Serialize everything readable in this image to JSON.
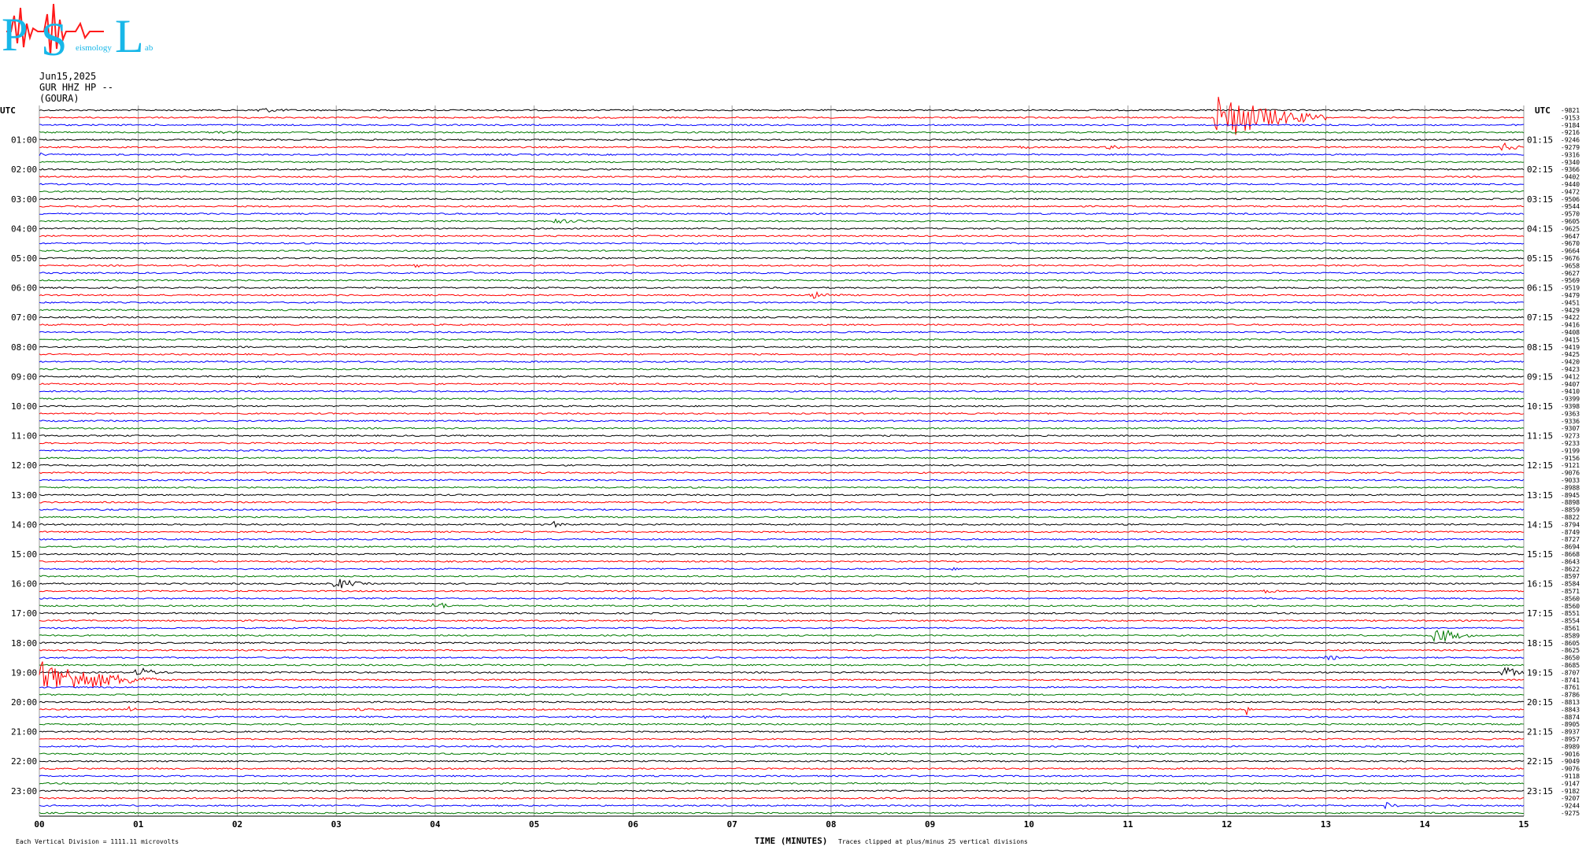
{
  "logo": {
    "letters": [
      "P",
      "S",
      "L"
    ],
    "words": [
      "eismology",
      "ab"
    ]
  },
  "header": {
    "date": "Jun15,2025",
    "channel": "GUR HHZ HP --",
    "station": "(GOURA)"
  },
  "chart_data": {
    "type": "line",
    "chart_kind": "helicorder",
    "title": "",
    "xlabel": "TIME (MINUTES)",
    "x_ticks": [
      "00",
      "01",
      "02",
      "03",
      "04",
      "05",
      "06",
      "07",
      "08",
      "09",
      "10",
      "11",
      "12",
      "13",
      "14",
      "15"
    ],
    "xlim": [
      0,
      15
    ],
    "utc_label_left": "UTC",
    "utc_label_right": "UTC",
    "left_hour_labels": [
      "01:00",
      "02:00",
      "03:00",
      "04:00",
      "05:00",
      "06:00",
      "07:00",
      "08:00",
      "09:00",
      "10:00",
      "11:00",
      "12:00",
      "13:00",
      "14:00",
      "15:00",
      "16:00",
      "17:00",
      "18:00",
      "19:00",
      "20:00",
      "21:00",
      "22:00",
      "23:00"
    ],
    "right_hour_labels": [
      "01:15",
      "02:15",
      "03:15",
      "04:15",
      "05:15",
      "06:15",
      "07:15",
      "08:15",
      "09:15",
      "10:15",
      "11:15",
      "12:15",
      "13:15",
      "14:15",
      "15:15",
      "16:15",
      "17:15",
      "18:15",
      "19:15",
      "20:15",
      "21:15",
      "22:15",
      "23:15"
    ],
    "trace_colors": [
      "#000000",
      "#ff0000",
      "#0000ff",
      "#007a00"
    ],
    "trace_count": 96,
    "right_offsets": [
      "-9821",
      "-9153",
      "-9184",
      "-9216",
      "-9246",
      "-9279",
      "-9316",
      "-9340",
      "-9366",
      "-9402",
      "-9440",
      "-9472",
      "-9506",
      "-9544",
      "-9570",
      "-9605",
      "-9625",
      "-9647",
      "-9670",
      "-9664",
      "-9676",
      "-9658",
      "-9627",
      "-9569",
      "-9519",
      "-9479",
      "-9451",
      "-9429",
      "-9422",
      "-9416",
      "-9408",
      "-9415",
      "-9419",
      "-9425",
      "-9420",
      "-9423",
      "-9412",
      "-9407",
      "-9410",
      "-9399",
      "-9398",
      "-9363",
      "-9336",
      "-9307",
      "-9273",
      "-9233",
      "-9199",
      "-9156",
      "-9121",
      "-9076",
      "-9033",
      "-8988",
      "-8945",
      "-8898",
      "-8859",
      "-8822",
      "-8794",
      "-8749",
      "-8727",
      "-8694",
      "-8668",
      "-8643",
      "-8622",
      "-8597",
      "-8584",
      "-8571",
      "-8560",
      "-8560",
      "-8551",
      "-8554",
      "-8561",
      "-8589",
      "-8605",
      "-8625",
      "-8650",
      "-8685",
      "-8707",
      "-8741",
      "-8761",
      "-8786",
      "-8813",
      "-8843",
      "-8874",
      "-8905",
      "-8937",
      "-8957",
      "-8989",
      "-9016",
      "-9049",
      "-9076",
      "-9118",
      "-9147",
      "-9182",
      "-9207",
      "-9244",
      "-9275"
    ],
    "events": [
      {
        "trace": 0,
        "minute": 2.2,
        "amp": 4,
        "dur": 0.6
      },
      {
        "trace": 1,
        "minute": 11.9,
        "amp": 34,
        "dur": 1.1
      },
      {
        "trace": 3,
        "minute": 1.8,
        "amp": 3,
        "dur": 0.6
      },
      {
        "trace": 5,
        "minute": 9.9,
        "amp": 2,
        "dur": 0.6
      },
      {
        "trace": 5,
        "minute": 10.8,
        "amp": 4,
        "dur": 0.3
      },
      {
        "trace": 5,
        "minute": 14.8,
        "amp": 10,
        "dur": 0.2
      },
      {
        "trace": 6,
        "minute": 0.0,
        "amp": 3,
        "dur": 0.2
      },
      {
        "trace": 12,
        "minute": 0.9,
        "amp": 2,
        "dur": 0.9
      },
      {
        "trace": 15,
        "minute": 5.2,
        "amp": 3,
        "dur": 1.0
      },
      {
        "trace": 21,
        "minute": 3.8,
        "amp": 3,
        "dur": 0.2
      },
      {
        "trace": 22,
        "minute": 4.3,
        "amp": 2,
        "dur": 0.4
      },
      {
        "trace": 25,
        "minute": 7.8,
        "amp": 5,
        "dur": 0.5
      },
      {
        "trace": 36,
        "minute": 2.2,
        "amp": 3,
        "dur": 0.1
      },
      {
        "trace": 43,
        "minute": 11.3,
        "amp": 2,
        "dur": 1.2
      },
      {
        "trace": 44,
        "minute": 14.9,
        "amp": 2,
        "dur": 0.1
      },
      {
        "trace": 46,
        "minute": 0.0,
        "amp": 2,
        "dur": 0.3
      },
      {
        "trace": 46,
        "minute": 10.3,
        "amp": 2,
        "dur": 0.6
      },
      {
        "trace": 49,
        "minute": 5.0,
        "amp": 2,
        "dur": 0.2
      },
      {
        "trace": 54,
        "minute": 4.8,
        "amp": 2,
        "dur": 0.1
      },
      {
        "trace": 56,
        "minute": 5.2,
        "amp": 4,
        "dur": 0.3
      },
      {
        "trace": 62,
        "minute": 9.2,
        "amp": 2,
        "dur": 0.4
      },
      {
        "trace": 64,
        "minute": 3.0,
        "amp": 8,
        "dur": 0.4
      },
      {
        "trace": 65,
        "minute": 12.4,
        "amp": 5,
        "dur": 0.2
      },
      {
        "trace": 67,
        "minute": 4.0,
        "amp": 7,
        "dur": 0.25
      },
      {
        "trace": 71,
        "minute": 14.1,
        "amp": 14,
        "dur": 0.4
      },
      {
        "trace": 74,
        "minute": 5.9,
        "amp": 4,
        "dur": 0.2
      },
      {
        "trace": 74,
        "minute": 13.0,
        "amp": 4,
        "dur": 0.4
      },
      {
        "trace": 75,
        "minute": 3.6,
        "amp": 2,
        "dur": 0.2
      },
      {
        "trace": 75,
        "minute": 13.8,
        "amp": 2,
        "dur": 0.2
      },
      {
        "trace": 76,
        "minute": 1.0,
        "amp": 7,
        "dur": 0.4
      },
      {
        "trace": 76,
        "minute": 14.8,
        "amp": 10,
        "dur": 0.25
      },
      {
        "trace": 77,
        "minute": 0.0,
        "amp": 28,
        "dur": 1.2
      },
      {
        "trace": 77,
        "minute": 7.8,
        "amp": 2,
        "dur": 0.2
      },
      {
        "trace": 80,
        "minute": 13.5,
        "amp": 2,
        "dur": 0.2
      },
      {
        "trace": 81,
        "minute": 0.9,
        "amp": 4,
        "dur": 0.2
      },
      {
        "trace": 81,
        "minute": 3.2,
        "amp": 3,
        "dur": 0.3
      },
      {
        "trace": 81,
        "minute": 12.2,
        "amp": 8,
        "dur": 0.1
      },
      {
        "trace": 82,
        "minute": 6.7,
        "amp": 3,
        "dur": 0.2
      },
      {
        "trace": 86,
        "minute": 11.1,
        "amp": 2,
        "dur": 0.2
      },
      {
        "trace": 94,
        "minute": 13.6,
        "amp": 5,
        "dur": 0.25
      }
    ]
  },
  "footer": {
    "vertical_division": "Each Vertical Division = 1111.11 microvolts",
    "clip_note": "Traces clipped at plus/minus 25 vertical divisions"
  }
}
